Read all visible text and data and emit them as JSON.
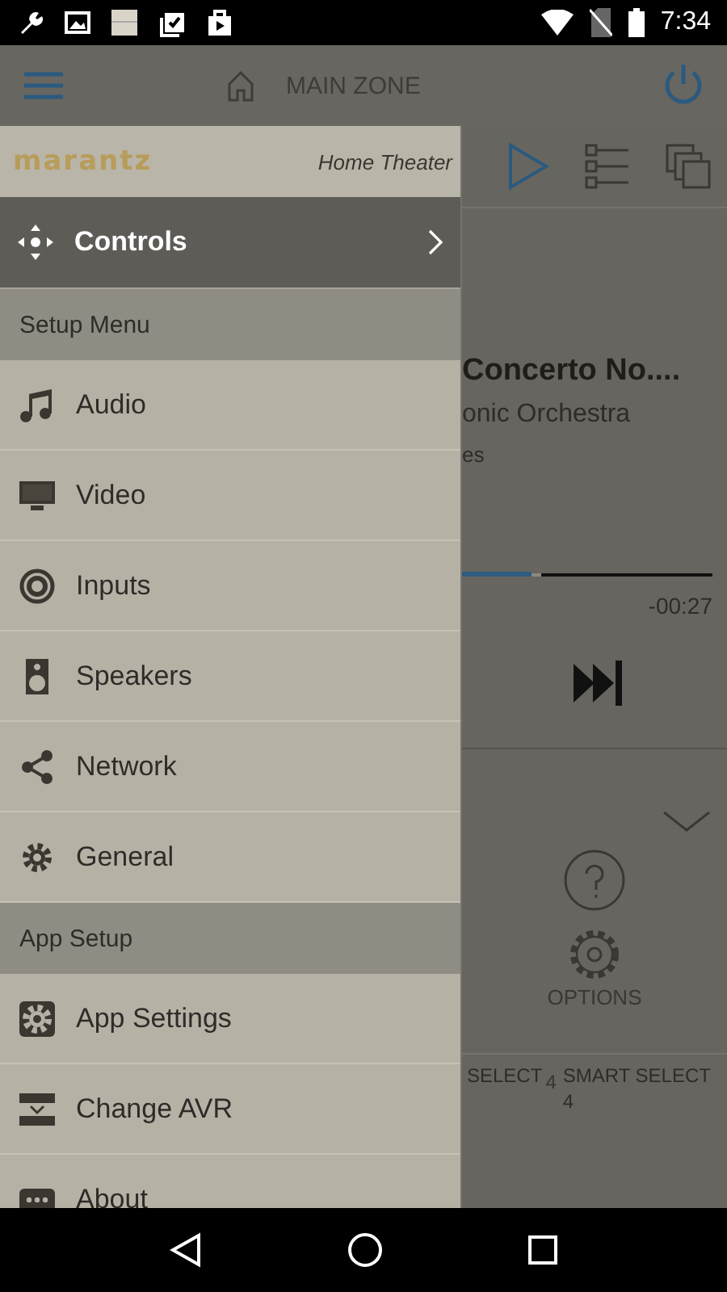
{
  "status_bar": {
    "time": "7:34"
  },
  "app_bar": {
    "title": "MAIN ZONE"
  },
  "drawer": {
    "brand": "marantz",
    "subtitle": "Home Theater",
    "controls": {
      "label": "Controls"
    },
    "sections": [
      {
        "title": "Setup Menu",
        "items": [
          {
            "label": "Audio",
            "kind": "audio"
          },
          {
            "label": "Video",
            "kind": "video"
          },
          {
            "label": "Inputs",
            "kind": "inputs"
          },
          {
            "label": "Speakers",
            "kind": "speakers"
          },
          {
            "label": "Network",
            "kind": "network"
          },
          {
            "label": "General",
            "kind": "general"
          }
        ]
      },
      {
        "title": "App Setup",
        "items": [
          {
            "label": "App Settings",
            "kind": "app-settings"
          },
          {
            "label": "Change AVR",
            "kind": "change-avr"
          },
          {
            "label": "About",
            "kind": "about"
          }
        ]
      }
    ]
  },
  "now_playing": {
    "title": "Concerto No....",
    "artist": "onic Orchestra",
    "album": "es",
    "level": 0.74,
    "remaining": "-00:27"
  },
  "options": {
    "label": "OPTIONS"
  },
  "bottom_tabs": [
    {
      "label": "SELECT",
      "badge": "4"
    },
    {
      "label": "SMART SELECT",
      "badge": "4"
    }
  ]
}
